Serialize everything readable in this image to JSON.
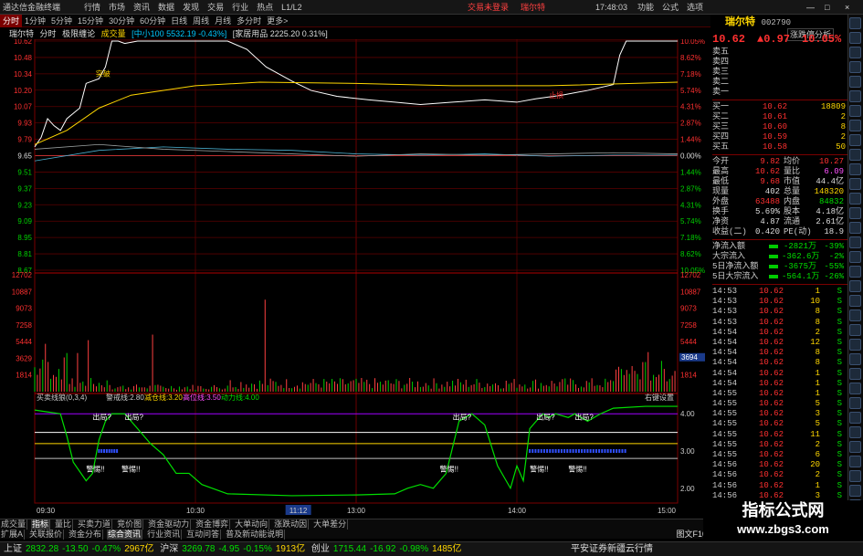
{
  "titlebar": {
    "app": "通达信金融终端",
    "menu": [
      "行情",
      "市场",
      "资讯",
      "数据",
      "发现",
      "交易",
      "行业",
      "热点",
      "L1/L2"
    ],
    "trade_login": "交易未登录",
    "stock_name": "瑞尔特",
    "time": "17:48:03",
    "right_menu": [
      "功能",
      "公式",
      "选项"
    ],
    "window_buttons": [
      "—",
      "□",
      "×"
    ]
  },
  "periods": [
    "分时",
    "1分钟",
    "5分钟",
    "15分钟",
    "30分钟",
    "60分钟",
    "日线",
    "周线",
    "月线",
    "多分时",
    "更多>"
  ],
  "chart": {
    "tabs": [
      "瑞尔特",
      "分时",
      "极限缠论"
    ],
    "vol_label": "成交量",
    "mini_index": "[中小100 5532.19 -0.43%]",
    "sector": "[家居用品 2225.20 0.31%]",
    "analysis_btn": "涨跌停分析",
    "price_ticks": [
      "10.62",
      "10.48",
      "10.34",
      "10.20",
      "10.07",
      "9.93",
      "9.79",
      "9.65",
      "9.51",
      "9.37",
      "9.23",
      "9.09",
      "8.95",
      "8.81",
      "8.67"
    ],
    "pct_ticks": [
      "10.05%",
      "8.62%",
      "7.18%",
      "5.74%",
      "4.31%",
      "2.87%",
      "1.44%",
      "0.00%",
      "1.44%",
      "2.87%",
      "4.31%",
      "5.74%",
      "7.18%",
      "8.62%",
      "10.05%"
    ],
    "vol_ticks": [
      "12702",
      "10887",
      "9073",
      "7258",
      "5444",
      "3629",
      "1814"
    ],
    "vol_marker": "3694",
    "annotations": {
      "breakout": "突破",
      "stop": "止损",
      "hot_label": "热门"
    },
    "indicator": {
      "name": "买卖线狼(0,3,4)",
      "params": [
        {
          "k": "警戒线:",
          "v": "2.80"
        },
        {
          "k": "减仓线:",
          "v": "3.20"
        },
        {
          "k": "高位线:",
          "v": "3.50"
        },
        {
          "k": "动力线:",
          "v": "4.00"
        }
      ],
      "settings": "右键设置",
      "scale": [
        "4.00",
        "3.00",
        "2.00"
      ],
      "signals": [
        "出局?",
        "出局?",
        "出局?",
        "出局?",
        "出局?"
      ],
      "warnings": [
        "警惕!!",
        "警惕!!",
        "警惕!!",
        "警惕!!",
        "警惕!!"
      ]
    },
    "time_ticks": [
      "09:30",
      "10:30",
      "11:12",
      "13:00",
      "14:00",
      "15:00"
    ]
  },
  "quote": {
    "name": "瑞尔特",
    "code": "002790",
    "price": "10.62",
    "change": "▲0.97",
    "pct": "10.05%",
    "asks": [
      {
        "l": "卖五",
        "p": "",
        "v": ""
      },
      {
        "l": "卖四",
        "p": "",
        "v": ""
      },
      {
        "l": "卖三",
        "p": "",
        "v": ""
      },
      {
        "l": "卖二",
        "p": "",
        "v": ""
      },
      {
        "l": "卖一",
        "p": "",
        "v": ""
      }
    ],
    "bids": [
      {
        "l": "买一",
        "p": "10.62",
        "v": "18809"
      },
      {
        "l": "买二",
        "p": "10.61",
        "v": "2"
      },
      {
        "l": "买三",
        "p": "10.60",
        "v": "8"
      },
      {
        "l": "买四",
        "p": "10.59",
        "v": "2"
      },
      {
        "l": "买五",
        "p": "10.58",
        "v": "50"
      }
    ],
    "stats": [
      {
        "k": "今开",
        "a": "9.82",
        "k2": "均价",
        "b": "10.27",
        "ca": "r",
        "cb": "r"
      },
      {
        "k": "最高",
        "a": "10.62",
        "k2": "量比",
        "b": "6.09",
        "ca": "r",
        "cb": "m"
      },
      {
        "k": "最低",
        "a": "9.68",
        "k2": "市值",
        "b": "44.4亿",
        "ca": "r",
        "cb": "w"
      },
      {
        "k": "现量",
        "a": "402",
        "k2": "总量",
        "b": "148320",
        "ca": "w",
        "cb": "y"
      },
      {
        "k": "外盘",
        "a": "63488",
        "k2": "内盘",
        "b": "84832",
        "ca": "r",
        "cb": "g"
      },
      {
        "k": "换手",
        "a": "5.69%",
        "k2": "股本",
        "b": "4.18亿",
        "ca": "w",
        "cb": "w"
      },
      {
        "k": "净资",
        "a": "4.87",
        "k2": "流通",
        "b": "2.61亿",
        "ca": "w",
        "cb": "w"
      },
      {
        "k": "收益(二)",
        "a": "0.420",
        "k2": "PE(动)",
        "b": "18.9",
        "ca": "w",
        "cb": "w"
      }
    ],
    "flows": [
      {
        "k": "净流入额",
        "a": "-2821万",
        "b": "-39%"
      },
      {
        "k": "大宗流入",
        "a": "-362.6万",
        "b": "-2%"
      },
      {
        "k": "5日净流入额",
        "a": "-3675万",
        "b": "-55%"
      },
      {
        "k": "5日大宗流入",
        "a": "-564.1万",
        "b": "-26%"
      }
    ],
    "ticks": [
      {
        "t": "14:53",
        "p": "10.62",
        "v": "1",
        "d": "S"
      },
      {
        "t": "14:53",
        "p": "10.62",
        "v": "10",
        "d": "S"
      },
      {
        "t": "14:53",
        "p": "10.62",
        "v": "8",
        "d": "S"
      },
      {
        "t": "14:53",
        "p": "10.62",
        "v": "8",
        "d": "S"
      },
      {
        "t": "14:54",
        "p": "10.62",
        "v": "2",
        "d": "S"
      },
      {
        "t": "14:54",
        "p": "10.62",
        "v": "12",
        "d": "S"
      },
      {
        "t": "14:54",
        "p": "10.62",
        "v": "8",
        "d": "S"
      },
      {
        "t": "14:54",
        "p": "10.62",
        "v": "8",
        "d": "S"
      },
      {
        "t": "14:54",
        "p": "10.62",
        "v": "1",
        "d": "S"
      },
      {
        "t": "14:54",
        "p": "10.62",
        "v": "1",
        "d": "S"
      },
      {
        "t": "14:55",
        "p": "10.62",
        "v": "1",
        "d": "S"
      },
      {
        "t": "14:55",
        "p": "10.62",
        "v": "5",
        "d": "S"
      },
      {
        "t": "14:55",
        "p": "10.62",
        "v": "3",
        "d": "S"
      },
      {
        "t": "14:55",
        "p": "10.62",
        "v": "5",
        "d": "S"
      },
      {
        "t": "14:55",
        "p": "10.62",
        "v": "11",
        "d": "S"
      },
      {
        "t": "14:55",
        "p": "10.62",
        "v": "2",
        "d": "S"
      },
      {
        "t": "14:55",
        "p": "10.62",
        "v": "6",
        "d": "S"
      },
      {
        "t": "14:56",
        "p": "10.62",
        "v": "20",
        "d": "S"
      },
      {
        "t": "14:56",
        "p": "10.62",
        "v": "2",
        "d": "S"
      },
      {
        "t": "14:56",
        "p": "10.62",
        "v": "1",
        "d": "S"
      },
      {
        "t": "14:56",
        "p": "10.62",
        "v": "3",
        "d": "S"
      },
      {
        "t": "14:56",
        "p": "10.62",
        "v": "5",
        "d": "S"
      },
      {
        "t": "14:56",
        "p": "10.62",
        "v": "1",
        "d": "S"
      },
      {
        "t": "14:56",
        "p": "10.62",
        "v": "1",
        "d": "S"
      },
      {
        "t": "15:00",
        "p": "10.62",
        "v": "402",
        "d": "S"
      }
    ]
  },
  "bottom_tabs": {
    "row1": [
      "成交量",
      "指标",
      "量比",
      "买卖力道",
      "竞价图",
      "资金驱动力",
      "资金博弈",
      "大单动向",
      "涨跌动因",
      "大单差分"
    ],
    "row2": [
      "扩展A",
      "关联报价",
      "资金分布",
      "综合资讯",
      "行业资讯",
      "互动问答",
      "普及新动能说明"
    ],
    "active1": "指标",
    "active2": "综合资讯",
    "right_label": "图文F10"
  },
  "statusbar": {
    "sh_name": "上证",
    "sh_val": "2832.28",
    "sh_chg": "-13.50",
    "sh_pct": "-0.47%",
    "sh_amt": "2967亿",
    "sz_name": "沪深",
    "sz_val": "3269.78",
    "sz_chg": "-4.95",
    "sz_pct": "-0.15%",
    "sz_amt": "1913亿",
    "cy_name": "创业",
    "cy_val": "1715.44",
    "cy_chg": "-16.92",
    "cy_pct": "-0.98%",
    "cy_amt": "1485亿",
    "broker": "平安证券新疆云行情"
  },
  "watermark": {
    "line1": "指标公式网",
    "line2": "www.zbgs3.com"
  },
  "colors": {
    "up": "#ff3030",
    "down": "#00e000",
    "price_line": "#ffffff",
    "avg_line": "#ffd700",
    "grid": "#7a0000"
  }
}
